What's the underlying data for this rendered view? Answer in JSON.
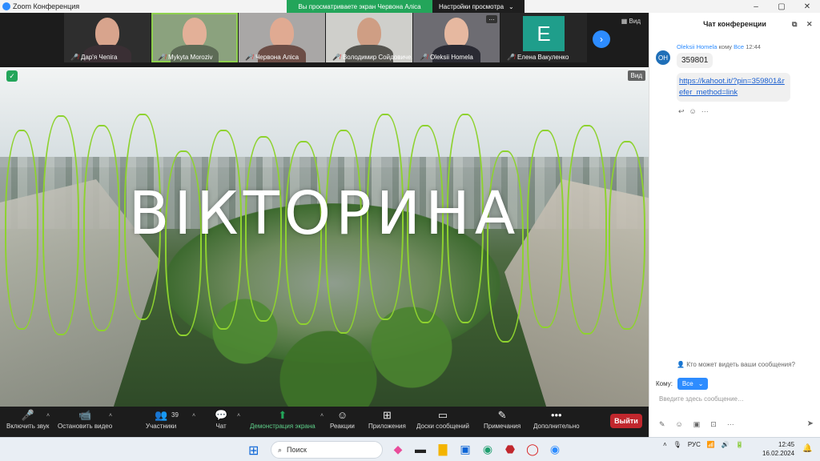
{
  "window": {
    "title": "Zoom Конференция",
    "share_banner": "Вы просматриваете экран Червона Аліса",
    "view_options": "Настройки просмотра",
    "view_options_caret": "⌄",
    "controls": [
      "–",
      "▢",
      "✕"
    ]
  },
  "gallery": {
    "view_label": "Вид",
    "next_icon": "›",
    "participants": [
      {
        "name": "Дар'я Чепіга",
        "bg": "#3d3b46",
        "face": "#d8a48d",
        "body": "#3a2f34"
      },
      {
        "name": "Mykyta Moroziv",
        "bg": "#8ba27e",
        "face": "#e3b098",
        "body": "#5d6b56",
        "active": true
      },
      {
        "name": "Червона Аліса",
        "bg": "#a9a7a6",
        "face": "#e0aa92",
        "body": "#6c4d46"
      },
      {
        "name": "Володимир Сойдовиче…",
        "bg": "#cfcfcb",
        "face": "#cf9e84",
        "body": "#55544f"
      },
      {
        "name": "Oleksii Homela",
        "bg": "#6d6c72",
        "face": "#e6b8a0",
        "body": "#2a2a33",
        "more": "…"
      },
      {
        "name": "Елена Вакуленко",
        "letter": "E"
      }
    ]
  },
  "shared_screen": {
    "title": "ВІКТОРИНА",
    "view_label": "Вид",
    "security_icon": "✓"
  },
  "toolbar": {
    "unmute": "Включить звук",
    "stop_video": "Остановить видео",
    "participants": "Участники",
    "participants_count": "39",
    "chat": "Чат",
    "share": "Демонстрация экрана",
    "reactions": "Реакции",
    "apps": "Приложения",
    "whiteboards": "Доски сообщений",
    "notes": "Примечания",
    "more": "Дополнительно",
    "leave": "Выйти",
    "caret": "˄",
    "icons": {
      "mic": "🎤",
      "video": "📹",
      "people": "👥",
      "chat": "💬",
      "share": "⬆",
      "reactions": "☺",
      "apps": "⊞",
      "whiteboard": "▭",
      "notes": "✎",
      "more": "•••"
    }
  },
  "chat": {
    "header": "Чат конференции",
    "sender": "Oleksii Homela",
    "recipient_text": "кому",
    "recipient": "Все",
    "time": "12:44",
    "avatar": "OH",
    "message1": "359801",
    "message2": "https://kahoot.it/?pin=359801&refer_method=link",
    "reactions": [
      "↩",
      "☺",
      "···"
    ],
    "who_can_see": "Кто может видеть ваши сообщения?",
    "to_label": "Кому:",
    "to_value": "Все",
    "placeholder": "Введите здесь сообщение…",
    "tools": [
      "✎",
      "☺",
      "▣",
      "⊡",
      "···"
    ],
    "send_icon": "➤",
    "header_icons": [
      "⧉",
      "✕"
    ],
    "chevron": "⌄"
  },
  "taskbar": {
    "search": "Поиск",
    "lang": "РУС",
    "time": "12:45",
    "date": "16.02.2024",
    "start_icon": "⊞",
    "search_icon": "⌕",
    "tray_icons": [
      "˄",
      "🎙",
      "📶",
      "🔊",
      "🔋"
    ],
    "bell": "🔔",
    "apps": [
      {
        "icon": "◆",
        "color": "#e94c9a"
      },
      {
        "icon": "▬",
        "color": "#222"
      },
      {
        "icon": "▇",
        "color": "#f4b400"
      },
      {
        "icon": "▣",
        "color": "#0a64d6"
      },
      {
        "icon": "◉",
        "color": "#1e9e6e"
      },
      {
        "icon": "⬣",
        "color": "#c1272d"
      },
      {
        "icon": "◯",
        "color": "#d81b1b"
      },
      {
        "icon": "◉",
        "color": "#2d8cff"
      }
    ]
  }
}
